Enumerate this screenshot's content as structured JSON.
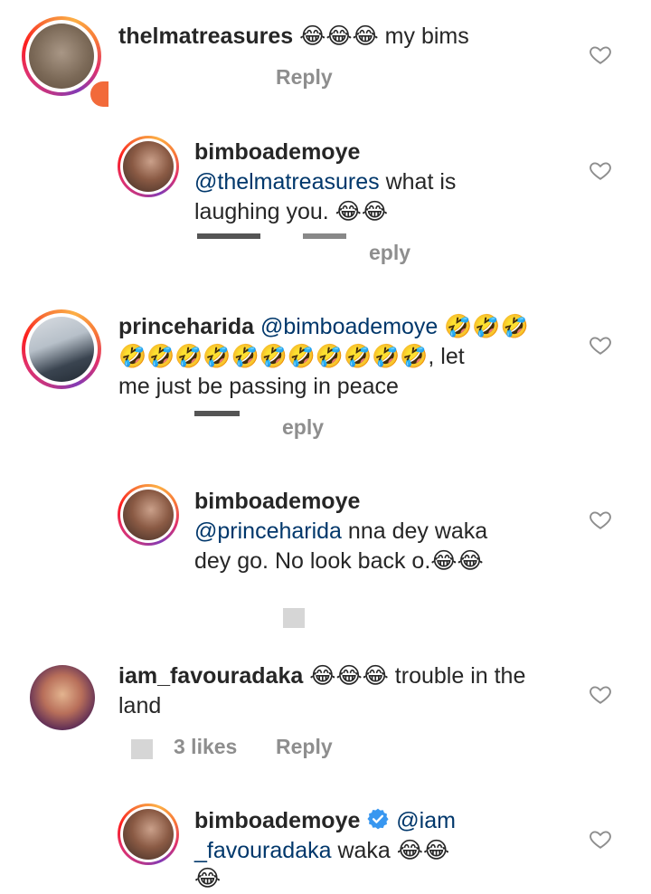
{
  "comments": [
    {
      "username": "thelmatreasures",
      "line1_rest": " 😂😂😂 my bims",
      "reply_label": "Reply"
    },
    {
      "username": "bimboademoye",
      "mention": "@thelmatreasures",
      "line1_rest": " what is",
      "line2": "laughing you. 😂😂",
      "reply_label": "eply"
    },
    {
      "username": "princeharida",
      "mention": "@bimboademoye",
      "line1_rest": " 🤣🤣🤣",
      "line2": "🤣🤣🤣🤣🤣🤣🤣🤣🤣🤣🤣, let",
      "line3": "me just be passing in peace",
      "reply_label": "eply"
    },
    {
      "username": "bimboademoye",
      "mention": "@princeharida",
      "line1_rest": " nna  dey waka",
      "line2": "dey go. No look back o.😂😂"
    },
    {
      "username": "iam_favouradaka",
      "line1_rest": " 😂😂😂 trouble in the",
      "line2": "land",
      "likes_label": "3 likes",
      "reply_label": "Reply"
    },
    {
      "username": "bimboademoye",
      "verified": true,
      "mention": "@iam",
      "mention2": "_favouradaka",
      "line1_rest": "",
      "line2_rest": " waka 😂😂",
      "line3": "😂"
    }
  ],
  "colors": {
    "text": "#262626",
    "mention": "#00376b",
    "meta": "#8e8e8e",
    "verified": "#3897f0"
  },
  "icons": {
    "like": "heart-outline-icon",
    "verified": "verified-badge-icon"
  }
}
